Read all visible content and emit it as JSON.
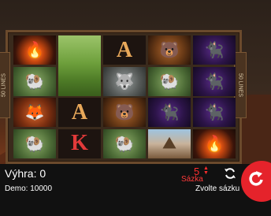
{
  "lines_left": "50 LINES",
  "lines_right": "50 LINES",
  "reels": [
    [
      {
        "symbol": "campfire",
        "tall": false
      },
      {
        "symbol": "ram",
        "tall": false
      },
      {
        "symbol": "fox",
        "tall": false
      },
      {
        "symbol": "ram",
        "tall": false
      }
    ],
    [
      {
        "symbol": "meadow",
        "tall": true
      },
      {
        "symbol": "letter-a",
        "label": "A",
        "tall": false
      },
      {
        "symbol": "letter-k",
        "label": "K",
        "tall": false
      }
    ],
    [
      {
        "symbol": "letter-a",
        "label": "A",
        "tall": false
      },
      {
        "symbol": "wolf",
        "tall": false
      },
      {
        "symbol": "bear",
        "tall": false
      },
      {
        "symbol": "ram",
        "tall": false
      }
    ],
    [
      {
        "symbol": "bear",
        "tall": false
      },
      {
        "symbol": "ram",
        "tall": false
      },
      {
        "symbol": "panther",
        "tall": false
      },
      {
        "symbol": "mountains",
        "tall": false
      }
    ],
    [
      {
        "symbol": "panther",
        "tall": false
      },
      {
        "symbol": "panther",
        "tall": false
      },
      {
        "symbol": "panther",
        "tall": false
      },
      {
        "symbol": "campfire",
        "tall": false
      }
    ]
  ],
  "win": {
    "label": "Výhra: 0"
  },
  "demo": {
    "label": "Demo:",
    "value": "10000"
  },
  "bet": {
    "value": "5",
    "label": "Sázka"
  },
  "choose_bet": "Zvolte sázku",
  "colors": {
    "accent": "#e5232b",
    "text": "#ffffff",
    "bar": "#111111"
  }
}
